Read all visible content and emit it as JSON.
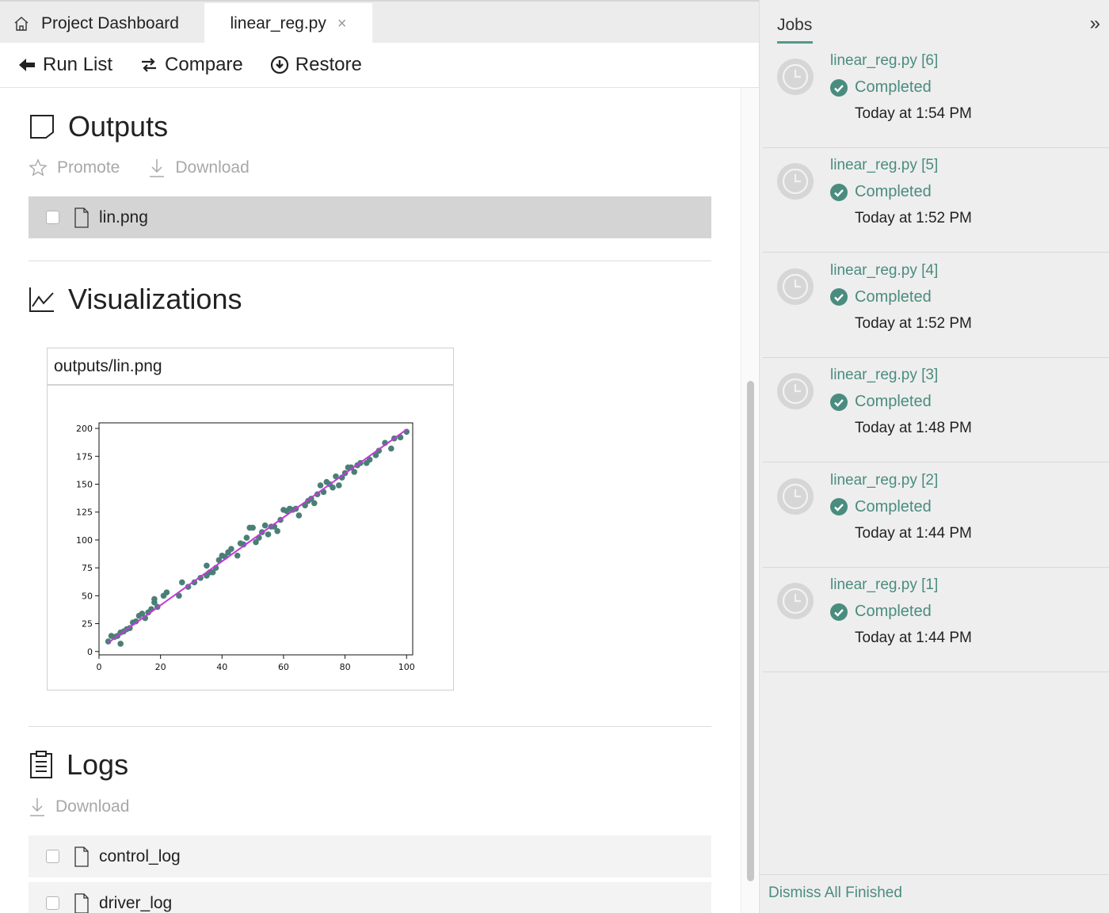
{
  "tabs": {
    "home_label": "Project Dashboard",
    "file_label": "linear_reg.py",
    "close_glyph": "×"
  },
  "toolbar": {
    "run_list": "Run List",
    "compare": "Compare",
    "restore": "Restore"
  },
  "outputs": {
    "title": "Outputs",
    "promote": "Promote",
    "download": "Download",
    "files": [
      "lin.png"
    ]
  },
  "visualizations": {
    "title": "Visualizations",
    "card_title": "outputs/lin.png"
  },
  "logs": {
    "title": "Logs",
    "download": "Download",
    "files": [
      "control_log",
      "driver_log"
    ]
  },
  "jobs": {
    "title": "Jobs",
    "collapse_glyph": "»",
    "items": [
      {
        "name": "linear_reg.py [6]",
        "status": "Completed",
        "time": "Today at 1:54 PM"
      },
      {
        "name": "linear_reg.py [5]",
        "status": "Completed",
        "time": "Today at 1:52 PM"
      },
      {
        "name": "linear_reg.py [4]",
        "status": "Completed",
        "time": "Today at 1:52 PM"
      },
      {
        "name": "linear_reg.py [3]",
        "status": "Completed",
        "time": "Today at 1:48 PM"
      },
      {
        "name": "linear_reg.py [2]",
        "status": "Completed",
        "time": "Today at 1:44 PM"
      },
      {
        "name": "linear_reg.py [1]",
        "status": "Completed",
        "time": "Today at 1:44 PM"
      }
    ],
    "dismiss": "Dismiss All Finished"
  },
  "colors": {
    "accent": "#4a8c7f",
    "scatter": "#4a7f77",
    "fit_line": "#c23ad6"
  },
  "chart_data": {
    "type": "scatter",
    "title": "",
    "xlabel": "",
    "ylabel": "",
    "xlim": [
      0,
      102
    ],
    "ylim": [
      -3,
      205
    ],
    "xticks": [
      0,
      20,
      40,
      60,
      80,
      100
    ],
    "yticks": [
      0,
      25,
      50,
      75,
      100,
      125,
      150,
      175,
      200
    ],
    "grid": false,
    "series": [
      {
        "kind": "points",
        "x": [
          3,
          4,
          5,
          6,
          7,
          7,
          8,
          9,
          10,
          11,
          12,
          13,
          14,
          15,
          16,
          17,
          18,
          18,
          19,
          21,
          22,
          26,
          27,
          29,
          31,
          33,
          35,
          35,
          36,
          37,
          38,
          39,
          40,
          41,
          42,
          43,
          45,
          46,
          47,
          48,
          49,
          50,
          51,
          52,
          53,
          54,
          55,
          56,
          57,
          58,
          59,
          60,
          61,
          62,
          63,
          64,
          65,
          67,
          68,
          69,
          70,
          71,
          72,
          73,
          74,
          75,
          76,
          77,
          78,
          79,
          80,
          81,
          82,
          83,
          84,
          85,
          87,
          88,
          90,
          91,
          93,
          95,
          96,
          98,
          100
        ],
        "y": [
          9,
          14,
          13,
          14,
          7,
          17,
          18,
          20,
          21,
          26,
          27,
          32,
          34,
          30,
          35,
          38,
          44,
          47,
          40,
          50,
          53,
          50,
          62,
          58,
          62,
          66,
          68,
          77,
          71,
          71,
          75,
          82,
          86,
          85,
          89,
          92,
          86,
          97,
          96,
          102,
          111,
          111,
          98,
          102,
          107,
          113,
          105,
          112,
          112,
          108,
          118,
          127,
          126,
          128,
          127,
          128,
          122,
          131,
          135,
          137,
          133,
          141,
          149,
          143,
          152,
          150,
          147,
          157,
          149,
          156,
          160,
          165,
          165,
          161,
          167,
          169,
          169,
          172,
          176,
          180,
          187,
          182,
          191,
          192,
          197
        ]
      },
      {
        "kind": "fit-line",
        "x": [
          3,
          100
        ],
        "y": [
          8,
          199
        ]
      }
    ]
  }
}
